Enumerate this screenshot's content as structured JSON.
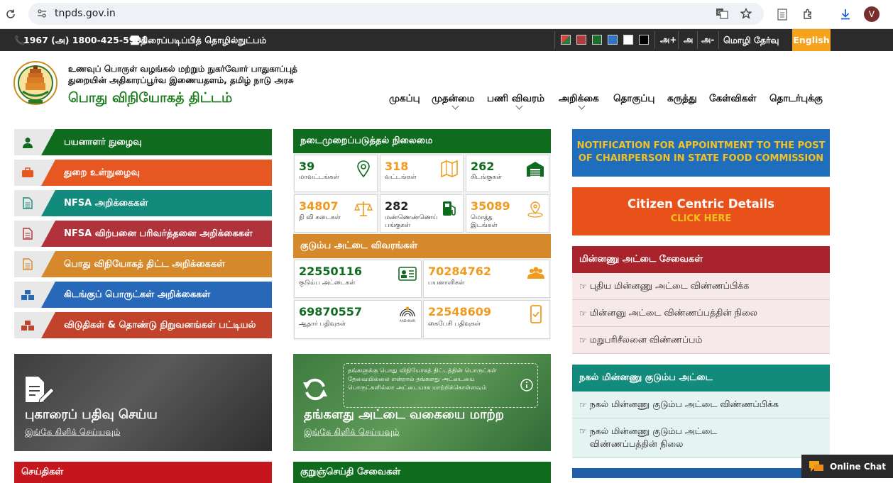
{
  "browser": {
    "url": "tnpds.gov.in",
    "profile_initial": "V"
  },
  "topbar": {
    "helpline": "1967 (அ) 1800-425-5901",
    "screen_reader": "திரைப்படிப்பித் தொழில்நுட்பம்",
    "font_increase": "அ+",
    "font_normal": "அ",
    "font_decrease": "அ-",
    "language_label": "மொழி தேர்வு",
    "language_button": "English",
    "theme_colors": [
      "#3a3a3a",
      "#b23b3b",
      "#1f6b2e",
      "#2f76c7",
      "#ffffff",
      "#000000"
    ]
  },
  "header": {
    "dept_line1": "உணவுப் பொருள் வழங்கல் மற்றும் நுகர்வோர் பாதுகாப்புத்",
    "dept_line2": "துறையின் அதிகாரப்பூர்வ இணையதளம், தமிழ் நாடு அரசு",
    "scheme_name": "பொது விநியோகத் திட்டம்"
  },
  "nav": [
    "முகப்பு",
    "முதன்மை",
    "பணி விவரம்",
    "அறிக்கை",
    "தொகுப்பு",
    "கருத்து",
    "கேள்விகள்",
    "தொடர்புக்கு"
  ],
  "left_menu": [
    {
      "label": "பயனாளர் நுழைவு",
      "color": "#0f6b1e"
    },
    {
      "label": "துறை உள்நுழைவு",
      "color": "#e65722"
    },
    {
      "label": "NFSA அறிக்கைகள்",
      "color": "#128a7c"
    },
    {
      "label": "NFSA விற்பனை பரிவர்த்தனை அறிக்கைகள்",
      "color": "#b0323b"
    },
    {
      "label": "பொது விநியோகத் திட்ட அறிக்கைகள்",
      "color": "#d6892a"
    },
    {
      "label": "கிடங்குப் பொருட்கள் அறிக்கைகள்",
      "color": "#2868b8"
    },
    {
      "label": "விடுதிகள் & தொண்டு நிறுவனங்கள் பட்டியல்",
      "color": "#c1432c"
    }
  ],
  "implementation": {
    "title": "நடைமுறைப்படுத்தல் நிலைமை",
    "stats": [
      {
        "value": "39",
        "label": "மாவட்டங்கள்"
      },
      {
        "value": "318",
        "label": "வட்டங்கள்"
      },
      {
        "value": "262",
        "label": "கிடங்குகள்"
      },
      {
        "value": "34807",
        "label": "நி வி கடைகள்"
      },
      {
        "value": "282",
        "label": "மண்ணெண்ணெய் பங்குகள்"
      },
      {
        "value": "35089",
        "label": "மொத்த இடங்கள்"
      }
    ]
  },
  "family_card": {
    "title": "குடும்ப அட்டை விவரங்கள்",
    "stats": [
      {
        "value": "22550116",
        "label": "குடும்ப அட்டைகள்"
      },
      {
        "value": "70284762",
        "label": "பயனாளிகள்"
      },
      {
        "value": "69870557",
        "label": "ஆதார் பதிவுகள்"
      },
      {
        "value": "22548609",
        "label": "கைபேசி பதிவுகள்"
      }
    ],
    "aadhaar_logo_text": "AADHAAR"
  },
  "complaint_card": {
    "title": "புகாரைப் பதிவு செய்ய",
    "link": "இங்கே கிளிக் செய்யவும்"
  },
  "change_card": {
    "title": "தங்களது அட்டை வகையை மாற்ற",
    "link": "இங்கே கிளிக் செய்யவும்",
    "info": "தங்களுக்கு பொது விநியோகத் திட்டத்தின் பொருட்கள் தேவையில்லை என்றால் தங்களது அட்டையை பொருட்களில்லா அட்டையாக மாற்றிக்கொள்ளவும்"
  },
  "bottom_left_head": "செய்திகள்",
  "bottom_mid_head": "குறுஞ்செய்தி சேவைகள்",
  "notification": "NOTIFICATION FOR APPOINTMENT TO THE POST OF CHAIRPERSON IN STATE FOOD COMMISSION",
  "citizen": {
    "title": "Citizen Centric Details",
    "cta": "CLICK HERE"
  },
  "smart_card": {
    "title": "மின்னணு அட்டை சேவைகள்",
    "items": [
      "புதிய மின்னணு அட்டை விண்ணப்பிக்க",
      "மின்னனு அட்டை விண்ணப்பத்தின் நிலை",
      "மறுபரிசீலனை விண்ணப்பம்"
    ]
  },
  "duplicate_card": {
    "title": "நகல் மின்னணு குடும்ப அட்டை",
    "items": [
      "நகல் மின்னணு குடும்ப அட்டை விண்ணப்பிக்க",
      "நகல் மின்னணு குடும்ப அட்டை விண்ணப்பத்தின் நிலை"
    ]
  },
  "chat": "Online Chat"
}
